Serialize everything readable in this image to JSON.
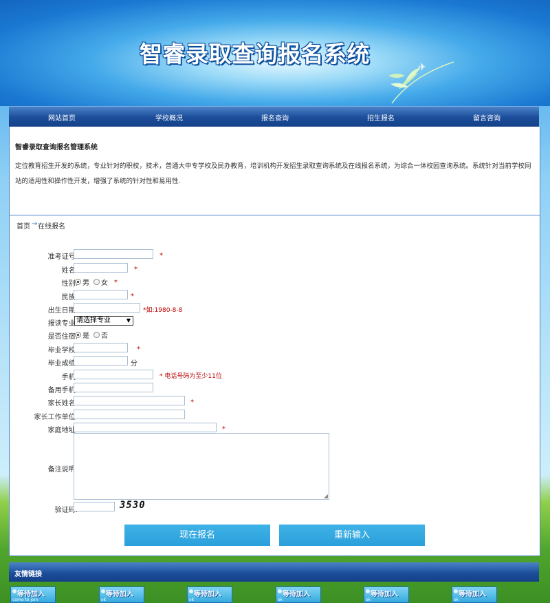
{
  "header": {
    "title": "智睿录取查询报名系统"
  },
  "nav": [
    "网站首页",
    "学校概况",
    "报名查询",
    "招生报名",
    "留言咨询"
  ],
  "intro": {
    "title": "智睿录取查询报名管理系统",
    "text": "定位教育招生开发的系统，专业针对的职校，技术，普通大中专学校及民办教育，培训机构开发招生录取查询系统及在线报名系统，为综合一体校园查询系统。系统针对当前学校网站的适用性和操作性开发，增强了系统的针对性和易用性."
  },
  "breadcrumb": {
    "home": "首页",
    "arrow": "→",
    "current": "在线报名"
  },
  "form": {
    "labels": {
      "exam_no": "准考证号:",
      "name": "姓名:",
      "gender": "性别:",
      "ethnicity": "民族:",
      "birth": "出生日期:",
      "major": "报读专业:",
      "boarding": "是否住宿:",
      "school": "毕业学校:",
      "score": "毕业成绩:",
      "mobile": "手机:",
      "mobile2": "备用手机:",
      "parent": "家长姓名:",
      "parent_work": "家长工作单位:",
      "address": "家庭地址:",
      "remark": "备注说明:",
      "captcha": "验证码:"
    },
    "required_mark": "*",
    "gender_options": [
      "男",
      "女"
    ],
    "boarding_options": [
      "是",
      "否"
    ],
    "birth_hint": "*如:1980-8-8",
    "major_selected": "请选择专业",
    "score_unit": "分",
    "mobile_hint": "* 电话号码为至少11位",
    "captcha_code": "3530",
    "submit_label": "现在报名",
    "reset_label": "重新输入"
  },
  "links": {
    "title": "友情链接",
    "badges": [
      {
        "text": "等待加入",
        "sub": "come to join"
      },
      {
        "text": "等待加入",
        "sub": "ok"
      },
      {
        "text": "等待加入",
        "sub": "ok"
      },
      {
        "text": "等待加入",
        "sub": "ok"
      },
      {
        "text": "等待加入",
        "sub": "ok"
      },
      {
        "text": "等待加入",
        "sub": "ok"
      }
    ]
  }
}
